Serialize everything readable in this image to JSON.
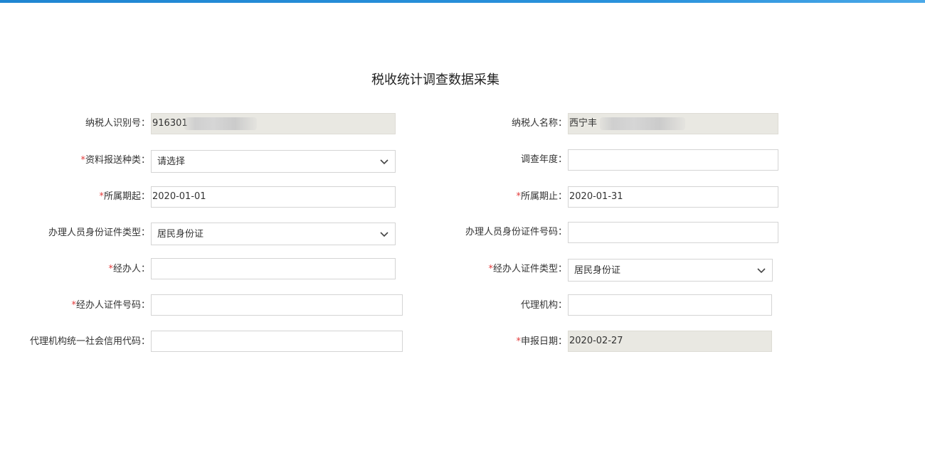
{
  "page": {
    "title": "税收统计调查数据采集"
  },
  "form": {
    "taxpayer_id_label": "纳税人识别号：",
    "taxpayer_id_value": "916301",
    "taxpayer_name_label": "纳税人名称：",
    "taxpayer_name_value": "西宁丰",
    "material_type_label": "资料报送种类：",
    "material_type_value": "请选择",
    "survey_year_label": "调查年度：",
    "survey_year_value": "",
    "period_start_label": "所属期起：",
    "period_start_value": "2020-01-01",
    "period_end_label": "所属期止：",
    "period_end_value": "2020-01-31",
    "handler_id_type_label": "办理人员身份证件类型：",
    "handler_id_type_value": "居民身份证",
    "handler_id_number_label": "办理人员身份证件号码：",
    "handler_id_number_value": "",
    "agent_label": "经办人：",
    "agent_value": "",
    "agent_id_type_label": "经办人证件类型：",
    "agent_id_type_value": "居民身份证",
    "agent_id_number_label": "经办人证件号码：",
    "agent_id_number_value": "",
    "agency_label": "代理机构：",
    "agency_value": "",
    "agency_credit_code_label": "代理机构统一社会信用代码：",
    "agency_credit_code_value": "",
    "report_date_label": "申报日期：",
    "report_date_value": "2020-02-27",
    "required_mark": "*"
  },
  "colors": {
    "accent_bar": "#1f86d2",
    "required": "#e23b3b",
    "readonly_bg": "#e9e8e2",
    "border": "#d4d4d4"
  },
  "icons": {
    "select_arrow": "chevron-down-icon"
  }
}
